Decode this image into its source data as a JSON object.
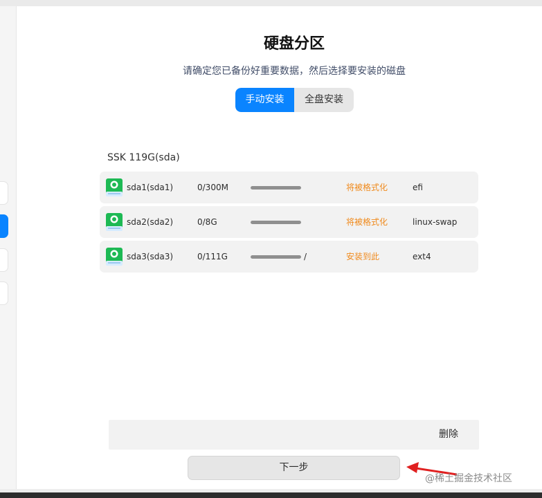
{
  "page": {
    "title": "硬盘分区",
    "subtitle": "请确定您已备份好重要数据，然后选择要安装的磁盘"
  },
  "mode_switch": {
    "manual_label": "手动安装",
    "full_disk_label": "全盘安装",
    "selected": "manual"
  },
  "disk": {
    "label": "SSK  119G(sda)",
    "partitions": [
      {
        "name": "sda1(sda1)",
        "usage": "0/300M",
        "usage_fraction": 0.0,
        "mount": "",
        "action": "将被格式化",
        "filesystem": "efi"
      },
      {
        "name": "sda2(sda2)",
        "usage": "0/8G",
        "usage_fraction": 0.0,
        "mount": "",
        "action": "将被格式化",
        "filesystem": "linux-swap"
      },
      {
        "name": "sda3(sda3)",
        "usage": "0/111G",
        "usage_fraction": 0.0,
        "mount": "/",
        "action": "安装到此",
        "filesystem": "ext4"
      }
    ]
  },
  "actions": {
    "delete_label": "删除",
    "next_label": "下一步"
  },
  "watermark": "@稀土掘金技术社区",
  "colors": {
    "accent": "#0a84ff",
    "warning_text": "#f08a1c",
    "row_bg": "#f2f2f2"
  }
}
